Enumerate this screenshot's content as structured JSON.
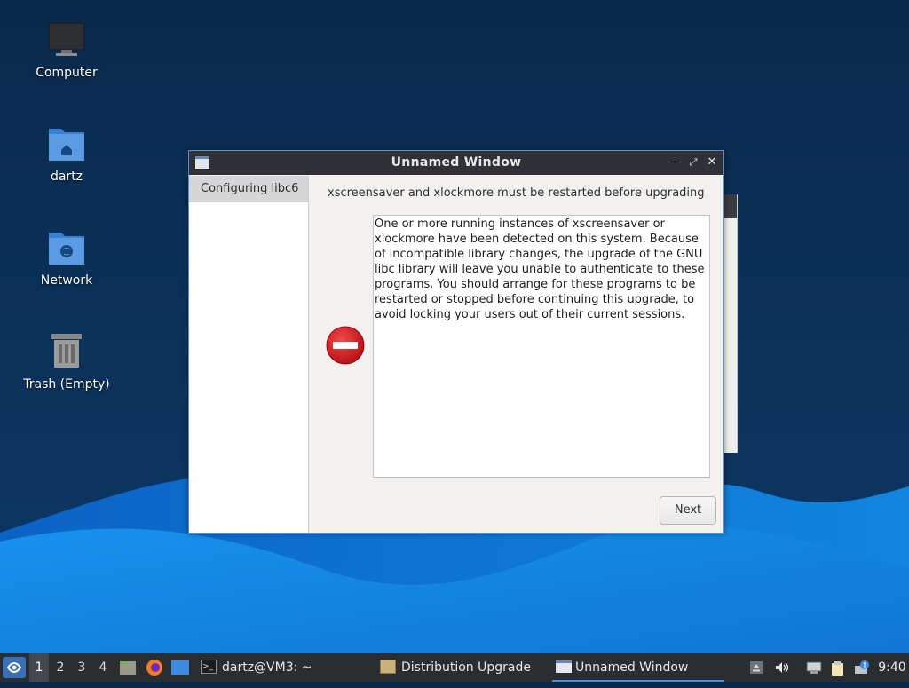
{
  "desktop": {
    "icons": [
      {
        "label": "Computer",
        "icon": "computer-icon"
      },
      {
        "label": "dartz",
        "icon": "home-folder-icon"
      },
      {
        "label": "Network",
        "icon": "network-folder-icon"
      },
      {
        "label": "Trash (Empty)",
        "icon": "trash-icon"
      }
    ]
  },
  "dialog": {
    "title": "Unnamed Window",
    "controls": [
      "minimize-icon",
      "maximize-icon",
      "close-icon"
    ],
    "sidebar": {
      "steps": [
        "Configuring libc6"
      ]
    },
    "heading": "xscreensaver and xlockmore must be restarted before upgrading",
    "message": "One or more running instances of xscreensaver or xlockmore have been detected on this system. Because of incompatible library changes, the upgrade of the GNU libc library will leave you unable to authenticate to these programs. You should arrange for these programs to be restarted or stopped before continuing this upgrade, to avoid locking your users out of their current sessions.",
    "icon": "stop-icon",
    "next_label": "Next"
  },
  "taskbar": {
    "workspaces": [
      "1",
      "2",
      "3",
      "4"
    ],
    "active_workspace": "1",
    "launchers": [
      "file-manager-icon",
      "firefox-icon",
      "show-desktop-icon"
    ],
    "tasks": [
      {
        "label": "dartz@VM3: ~",
        "icon": "terminal-icon"
      },
      {
        "label": "Distribution Upgrade",
        "icon": "package-icon"
      },
      {
        "label": "Unnamed Window",
        "icon": "window-icon"
      }
    ],
    "tray": [
      "eject-icon",
      "volume-icon",
      "network-icon",
      "clipboard-icon",
      "notification-icon"
    ],
    "clock": "9:40"
  },
  "colors": {
    "wallpaper_dark": "#0b2d55",
    "wallpaper_light": "#1a8de8",
    "accent": "#4a90d9",
    "titlebar": "#2f3136",
    "stop_red": "#d0141a"
  }
}
